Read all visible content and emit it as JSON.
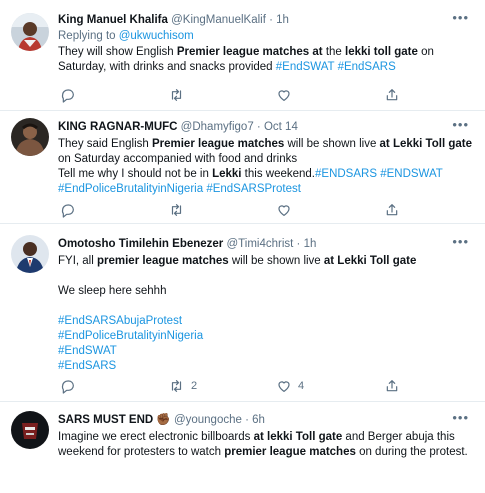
{
  "tweets": [
    {
      "name": "King Manuel Khalifa",
      "handle": "@KingManuelKalif",
      "time": "1h",
      "replying_prefix": "Replying to ",
      "replying_to": "@ukwuchisom",
      "text_1": "They will show English ",
      "bold_1": "Premier league matches at",
      "text_2": " the ",
      "bold_2": "lekki toll gate",
      "text_3": " on Saturday, with drinks and snacks provided ",
      "tag_1": "#EndSWAT",
      "tag_2": "#EndSARS",
      "reply_count": "",
      "retweet_count": "",
      "like_count": ""
    },
    {
      "name": "KING RAGNAR-MUFC",
      "handle": "@Dhamyfigo7",
      "time": "Oct 14",
      "text_1": "They said English ",
      "bold_1": "Premier league matches",
      "text_2": " will be shown live ",
      "bold_2": "at Lekki Toll gate",
      "text_3": " on Saturday accompanied with food and drinks",
      "text_4": "Tell me why I should not be in ",
      "bold_3": "Lekki",
      "text_5": " this weekend.",
      "tag_1": "#ENDSARS",
      "tag_2": "#ENDSWAT",
      "tag_3": "#EndPoliceBrutalityinNigeria",
      "tag_4": "#EndSARSProtest",
      "reply_count": "",
      "retweet_count": "",
      "like_count": ""
    },
    {
      "name": "Omotosho Timilehin Ebenezer",
      "handle": "@Timi4christ",
      "time": "1h",
      "text_1": "FYI, all ",
      "bold_1": "premier league matches",
      "text_2": " will be shown live ",
      "bold_2": "at Lekki Toll gate",
      "text_3": "We sleep here sehhh",
      "tag_1": "#EndSARSAbujaProtest",
      "tag_2": "#EndPoliceBrutalityinNigeria",
      "tag_3": "#EndSWAT",
      "tag_4": "#EndSARS",
      "reply_count": "",
      "retweet_count": "2",
      "like_count": "4"
    },
    {
      "name": "SARS MUST END",
      "emoji": "✊🏾",
      "handle": "@youngoche",
      "time": "6h",
      "text_1": "Imagine we erect electronic billboards ",
      "bold_1": "at lekki Toll gate",
      "text_2": " and Berger abuja this weekend for protesters to watch ",
      "bold_2": "premier league matches",
      "text_3": " on during the protest."
    }
  ],
  "ui": {
    "dot": "·",
    "more": "•••"
  },
  "colors": {
    "link": "#1b95e0",
    "muted": "#5b7083",
    "divider": "#e6ecf0"
  }
}
